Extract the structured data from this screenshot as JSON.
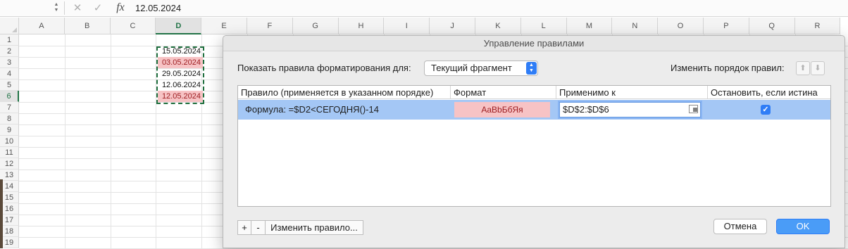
{
  "formula_bar": {
    "cancel_icon": "close-icon",
    "enter_icon": "checkmark-icon",
    "fx_label": "fx",
    "value": "12.05.2024"
  },
  "sheet": {
    "columns": [
      "A",
      "B",
      "C",
      "D",
      "E",
      "F",
      "G",
      "H",
      "I",
      "J",
      "K",
      "L",
      "M",
      "N",
      "O",
      "P",
      "Q",
      "R"
    ],
    "selected_column": "D",
    "rows": [
      "1",
      "2",
      "3",
      "4",
      "5",
      "6",
      "7",
      "8",
      "9",
      "10",
      "11",
      "12",
      "13",
      "14",
      "15",
      "16",
      "17",
      "18",
      "19"
    ],
    "selected_row": "6",
    "column_d_values": [
      "15.05.2024",
      "03.05.2024",
      "29.05.2024",
      "12.06.2024",
      "12.05.2024"
    ],
    "highlight_color": "#f7c3c5",
    "selection_color": "#217346"
  },
  "dialog": {
    "title": "Управление правилами",
    "show_rules_label": "Показать правила форматирования для:",
    "scope_value": "Текущий фрагмент",
    "reorder_label": "Изменить порядок правил:",
    "columns": {
      "rule": "Правило (применяется в указанном порядке)",
      "format": "Формат",
      "applies_to": "Применимо к",
      "stop_if_true": "Остановить, если истина"
    },
    "rule": {
      "formula": "Формула: =$D2<СЕГОДНЯ()-14",
      "format_preview": "AaBbБбЯя",
      "applies_to": "$D$2:$D$6",
      "stop_if_true": true
    },
    "buttons": {
      "add": "+",
      "remove": "-",
      "edit": "Изменить правило...",
      "cancel": "Отмена",
      "ok": "OK"
    },
    "accent_color": "#2f7df6",
    "row_highlight_color": "#a4c7f5"
  }
}
